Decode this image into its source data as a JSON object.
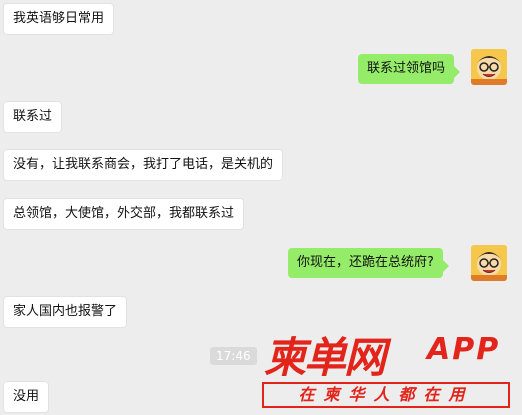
{
  "messages": [
    {
      "side": "left",
      "text": "我英语够日常用"
    },
    {
      "side": "right",
      "text": "联系过领馆吗"
    },
    {
      "side": "left",
      "text": "联系过"
    },
    {
      "side": "left",
      "text": "没有，让我联系商会，我打了电话，是关机的"
    },
    {
      "side": "left",
      "text": "总领馆，大使馆，外交部，我都联系过"
    },
    {
      "side": "right",
      "text": "你现在，还跪在总统府?"
    },
    {
      "side": "left",
      "text": "家人国内也报警了"
    },
    {
      "side": "left",
      "text": "没用"
    }
  ],
  "timestamp": "17:46",
  "watermark": {
    "brand_cn": "柬单网",
    "brand_app": "APP",
    "slogan": "在柬华人都在用"
  },
  "colors": {
    "background": "#ededed",
    "incoming_bubble": "#ffffff",
    "outgoing_bubble": "#95ec69",
    "watermark": "#e3241b"
  }
}
